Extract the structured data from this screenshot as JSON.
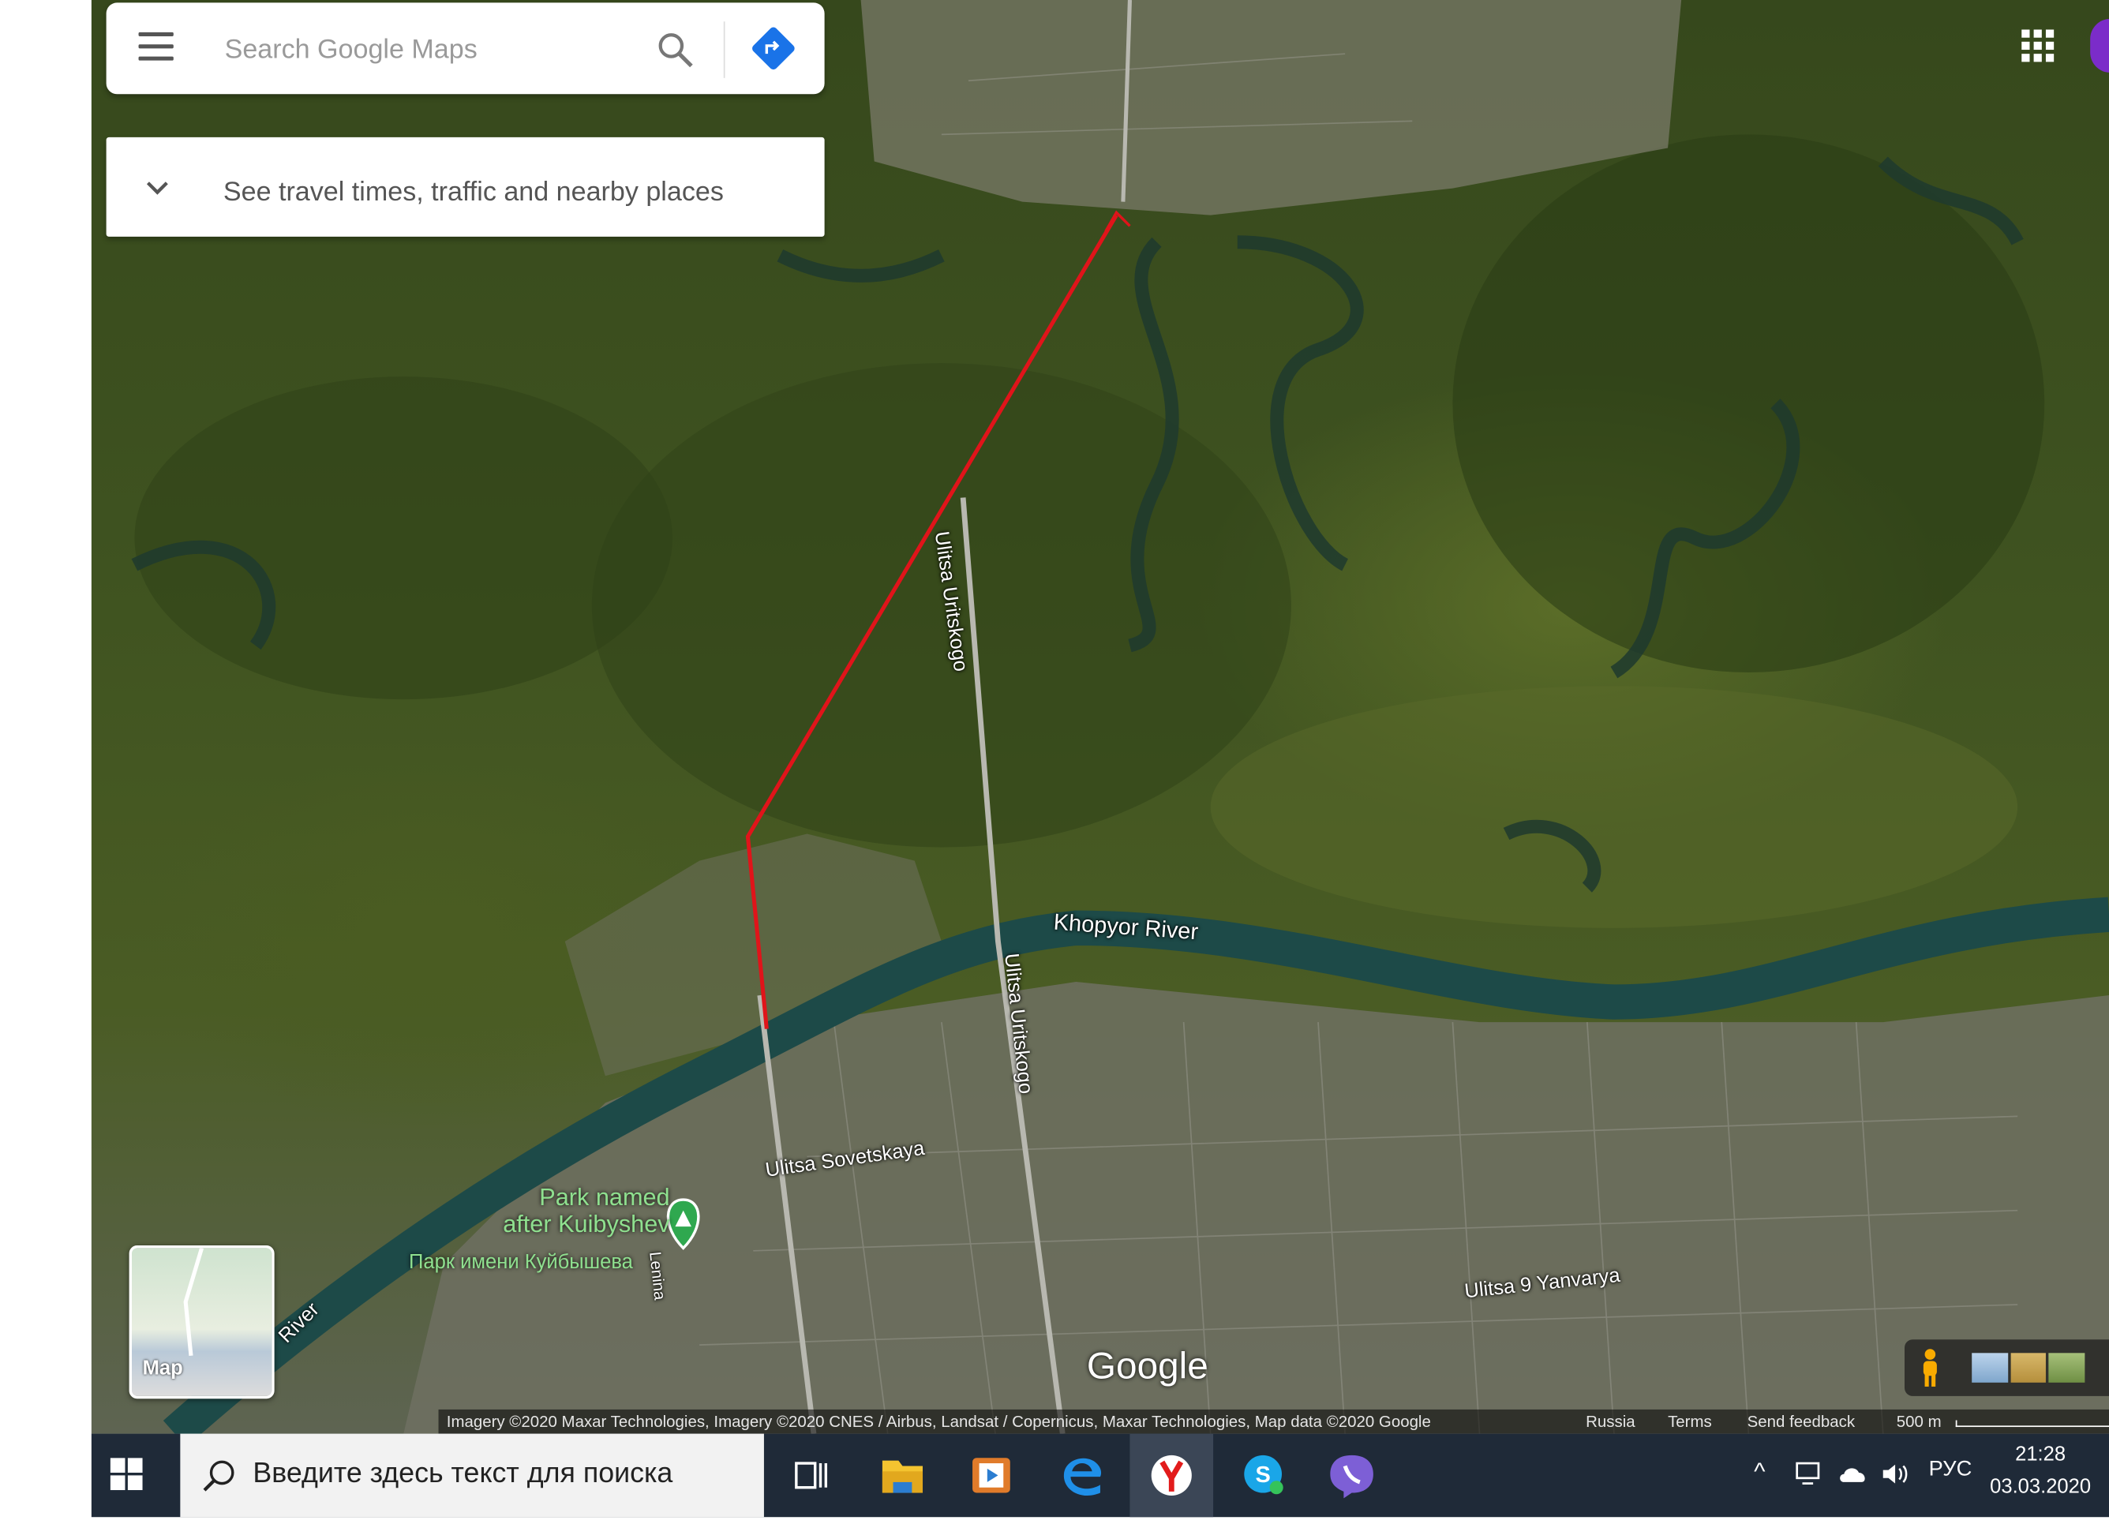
{
  "search": {
    "placeholder": "Search Google Maps",
    "menu_icon": "menu-icon",
    "search_icon": "search-icon",
    "directions_icon": "directions-icon"
  },
  "travel_panel": {
    "label": "See travel times, traffic and nearby places",
    "icon": "chevron-down-icon"
  },
  "map_labels": {
    "street_uritskogo_1": "Ulitsa Uritskogo",
    "street_uritskogo_2": "Ulitsa Uritskogo",
    "river": "Khopyor River",
    "river_left": "River",
    "street_sovetskaya": "Ulitsa Sovetskaya",
    "street_9_yanvarya": "Ulitsa 9 Yanvarya",
    "street_lenina": "Lenina",
    "park_en": "Park named after Kuibyshev",
    "park_ru": "Парк имени Куйбышева"
  },
  "layer_switch": {
    "label": "Map"
  },
  "brand": {
    "logo": "Google"
  },
  "attribution": {
    "imagery": "Imagery ©2020 Maxar Technologies, Imagery ©2020 CNES / Airbus, Landsat / Copernicus, Maxar Technologies, Map data ©2020 Google",
    "country": "Russia",
    "terms": "Terms",
    "feedback": "Send feedback",
    "scale": "500 m"
  },
  "taskbar": {
    "search_placeholder": "Введите здесь текст для поиска",
    "language": "РУС",
    "time": "21:28",
    "date": "03.03.2020"
  },
  "colors": {
    "route": "#e0141a",
    "river": "#1d4a48",
    "taskbar": "#1f2a38",
    "pin": "#2fa84f",
    "avatar": "#7b2cc9"
  }
}
